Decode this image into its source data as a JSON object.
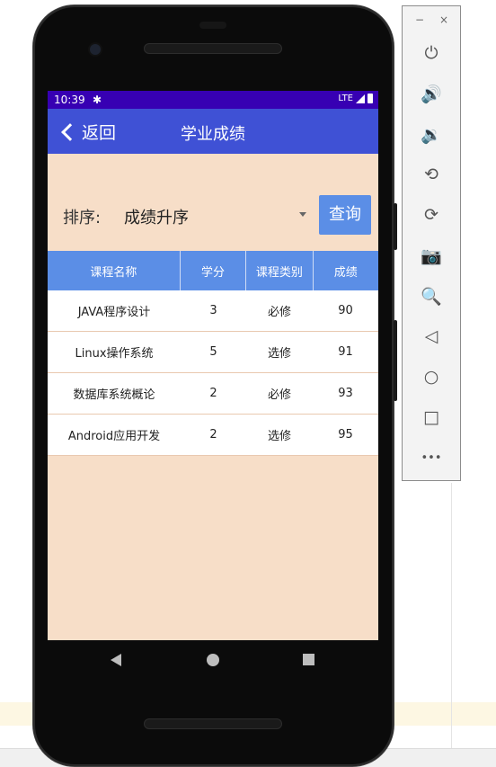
{
  "status_bar": {
    "time": "10:39",
    "network": "LTE"
  },
  "app_bar": {
    "back_label": "返回",
    "title": "学业成绩"
  },
  "filter": {
    "sort_label": "排序:",
    "sort_value": "成绩升序",
    "query_label": "查询"
  },
  "table": {
    "headers": [
      "课程名称",
      "学分",
      "课程类别",
      "成绩"
    ],
    "rows": [
      [
        "JAVA程序设计",
        "3",
        "必修",
        "90"
      ],
      [
        "Linux操作系统",
        "5",
        "选修",
        "91"
      ],
      [
        "数据库系统概论",
        "2",
        "必修",
        "93"
      ],
      [
        "Android应用开发",
        "2",
        "选修",
        "95"
      ]
    ]
  },
  "emulator": {
    "minimize": "−",
    "close": "×",
    "buttons": [
      {
        "icon": "power-icon",
        "glyph": "⏻"
      },
      {
        "icon": "volume-up-icon",
        "glyph": "🔊"
      },
      {
        "icon": "volume-down-icon",
        "glyph": "🔉"
      },
      {
        "icon": "rotate-left-icon",
        "glyph": "⟲"
      },
      {
        "icon": "rotate-right-icon",
        "glyph": "⟳"
      },
      {
        "icon": "camera-icon",
        "glyph": "📷"
      },
      {
        "icon": "zoom-icon",
        "glyph": "🔍"
      },
      {
        "icon": "back-icon",
        "glyph": "◁"
      },
      {
        "icon": "home-icon",
        "glyph": "○"
      },
      {
        "icon": "overview-icon",
        "glyph": "□"
      },
      {
        "icon": "more-icon",
        "glyph": "•••"
      }
    ]
  }
}
